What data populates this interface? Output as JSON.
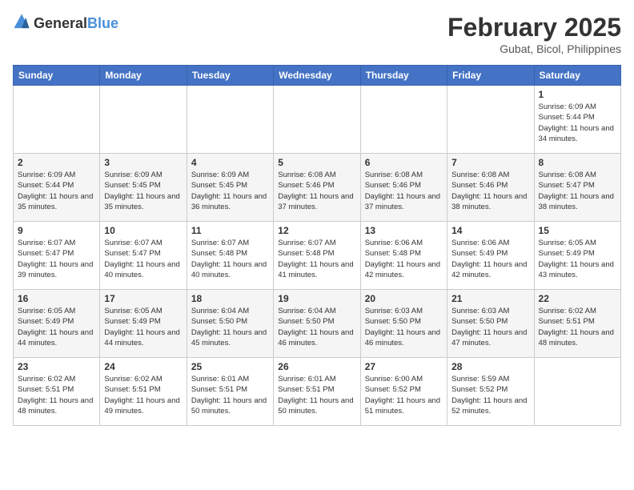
{
  "header": {
    "logo_general": "General",
    "logo_blue": "Blue",
    "month_title": "February 2025",
    "location": "Gubat, Bicol, Philippines"
  },
  "days_of_week": [
    "Sunday",
    "Monday",
    "Tuesday",
    "Wednesday",
    "Thursday",
    "Friday",
    "Saturday"
  ],
  "weeks": [
    [
      {
        "day": "",
        "info": ""
      },
      {
        "day": "",
        "info": ""
      },
      {
        "day": "",
        "info": ""
      },
      {
        "day": "",
        "info": ""
      },
      {
        "day": "",
        "info": ""
      },
      {
        "day": "",
        "info": ""
      },
      {
        "day": "1",
        "info": "Sunrise: 6:09 AM\nSunset: 5:44 PM\nDaylight: 11 hours and 34 minutes."
      }
    ],
    [
      {
        "day": "2",
        "info": "Sunrise: 6:09 AM\nSunset: 5:44 PM\nDaylight: 11 hours and 35 minutes."
      },
      {
        "day": "3",
        "info": "Sunrise: 6:09 AM\nSunset: 5:45 PM\nDaylight: 11 hours and 35 minutes."
      },
      {
        "day": "4",
        "info": "Sunrise: 6:09 AM\nSunset: 5:45 PM\nDaylight: 11 hours and 36 minutes."
      },
      {
        "day": "5",
        "info": "Sunrise: 6:08 AM\nSunset: 5:46 PM\nDaylight: 11 hours and 37 minutes."
      },
      {
        "day": "6",
        "info": "Sunrise: 6:08 AM\nSunset: 5:46 PM\nDaylight: 11 hours and 37 minutes."
      },
      {
        "day": "7",
        "info": "Sunrise: 6:08 AM\nSunset: 5:46 PM\nDaylight: 11 hours and 38 minutes."
      },
      {
        "day": "8",
        "info": "Sunrise: 6:08 AM\nSunset: 5:47 PM\nDaylight: 11 hours and 38 minutes."
      }
    ],
    [
      {
        "day": "9",
        "info": "Sunrise: 6:07 AM\nSunset: 5:47 PM\nDaylight: 11 hours and 39 minutes."
      },
      {
        "day": "10",
        "info": "Sunrise: 6:07 AM\nSunset: 5:47 PM\nDaylight: 11 hours and 40 minutes."
      },
      {
        "day": "11",
        "info": "Sunrise: 6:07 AM\nSunset: 5:48 PM\nDaylight: 11 hours and 40 minutes."
      },
      {
        "day": "12",
        "info": "Sunrise: 6:07 AM\nSunset: 5:48 PM\nDaylight: 11 hours and 41 minutes."
      },
      {
        "day": "13",
        "info": "Sunrise: 6:06 AM\nSunset: 5:48 PM\nDaylight: 11 hours and 42 minutes."
      },
      {
        "day": "14",
        "info": "Sunrise: 6:06 AM\nSunset: 5:49 PM\nDaylight: 11 hours and 42 minutes."
      },
      {
        "day": "15",
        "info": "Sunrise: 6:05 AM\nSunset: 5:49 PM\nDaylight: 11 hours and 43 minutes."
      }
    ],
    [
      {
        "day": "16",
        "info": "Sunrise: 6:05 AM\nSunset: 5:49 PM\nDaylight: 11 hours and 44 minutes."
      },
      {
        "day": "17",
        "info": "Sunrise: 6:05 AM\nSunset: 5:49 PM\nDaylight: 11 hours and 44 minutes."
      },
      {
        "day": "18",
        "info": "Sunrise: 6:04 AM\nSunset: 5:50 PM\nDaylight: 11 hours and 45 minutes."
      },
      {
        "day": "19",
        "info": "Sunrise: 6:04 AM\nSunset: 5:50 PM\nDaylight: 11 hours and 46 minutes."
      },
      {
        "day": "20",
        "info": "Sunrise: 6:03 AM\nSunset: 5:50 PM\nDaylight: 11 hours and 46 minutes."
      },
      {
        "day": "21",
        "info": "Sunrise: 6:03 AM\nSunset: 5:50 PM\nDaylight: 11 hours and 47 minutes."
      },
      {
        "day": "22",
        "info": "Sunrise: 6:02 AM\nSunset: 5:51 PM\nDaylight: 11 hours and 48 minutes."
      }
    ],
    [
      {
        "day": "23",
        "info": "Sunrise: 6:02 AM\nSunset: 5:51 PM\nDaylight: 11 hours and 48 minutes."
      },
      {
        "day": "24",
        "info": "Sunrise: 6:02 AM\nSunset: 5:51 PM\nDaylight: 11 hours and 49 minutes."
      },
      {
        "day": "25",
        "info": "Sunrise: 6:01 AM\nSunset: 5:51 PM\nDaylight: 11 hours and 50 minutes."
      },
      {
        "day": "26",
        "info": "Sunrise: 6:01 AM\nSunset: 5:51 PM\nDaylight: 11 hours and 50 minutes."
      },
      {
        "day": "27",
        "info": "Sunrise: 6:00 AM\nSunset: 5:52 PM\nDaylight: 11 hours and 51 minutes."
      },
      {
        "day": "28",
        "info": "Sunrise: 5:59 AM\nSunset: 5:52 PM\nDaylight: 11 hours and 52 minutes."
      },
      {
        "day": "",
        "info": ""
      }
    ]
  ]
}
